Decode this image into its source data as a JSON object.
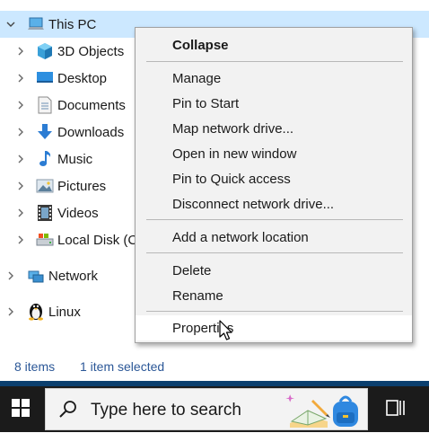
{
  "tree": {
    "this_pc": "This PC",
    "items": [
      {
        "label": "3D Objects",
        "icon": "3d-objects-icon"
      },
      {
        "label": "Desktop",
        "icon": "desktop-icon"
      },
      {
        "label": "Documents",
        "icon": "documents-icon"
      },
      {
        "label": "Downloads",
        "icon": "downloads-icon"
      },
      {
        "label": "Music",
        "icon": "music-icon"
      },
      {
        "label": "Pictures",
        "icon": "pictures-icon"
      },
      {
        "label": "Videos",
        "icon": "videos-icon"
      },
      {
        "label": "Local Disk (C",
        "icon": "local-disk-icon"
      }
    ],
    "network": "Network",
    "linux": "Linux"
  },
  "status": {
    "items_count": "8 items",
    "selection": "1 item selected"
  },
  "context_menu": {
    "items": [
      {
        "label": "Collapse",
        "bold": true
      },
      {
        "label": "Manage"
      },
      {
        "label": "Pin to Start"
      },
      {
        "label": "Map network drive..."
      },
      {
        "label": "Open in new window"
      },
      {
        "label": "Pin to Quick access"
      },
      {
        "label": "Disconnect network drive..."
      },
      {
        "label": "Add a network location"
      },
      {
        "label": "Delete"
      },
      {
        "label": "Rename"
      },
      {
        "label": "Properties",
        "hovered": true
      }
    ]
  },
  "taskbar": {
    "search_placeholder": "Type here to search"
  },
  "colors": {
    "selection": "#cce8ff",
    "menu_bg": "#f2f2f2",
    "taskbar": "#1b1b1b",
    "status_text": "#2b5797"
  }
}
